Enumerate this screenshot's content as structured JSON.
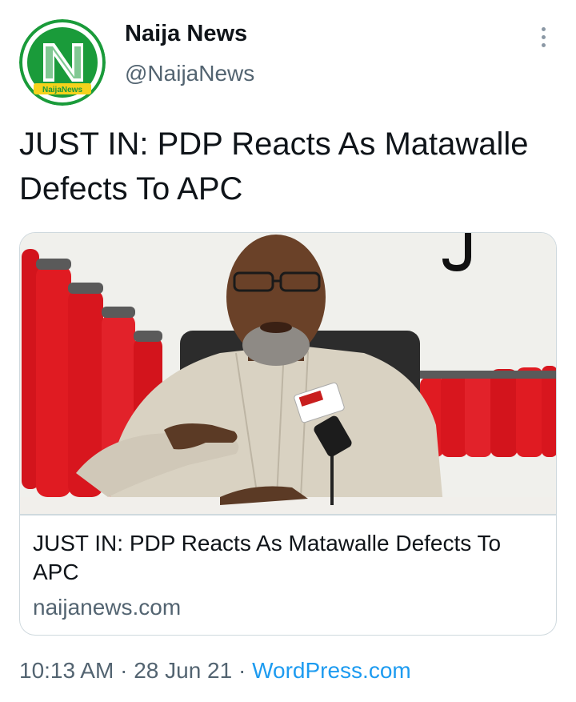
{
  "author": {
    "name": "Naija News",
    "handle": "@NaijaNews",
    "avatar_logo_text": "NaijaNews",
    "brand_green": "#1a9b3a"
  },
  "tweet": {
    "text": "JUST IN: PDP Reacts As Matawalle Defects To APC"
  },
  "card": {
    "title": "JUST IN: PDP Reacts As Matawalle Defects To APC",
    "domain": "naijanews.com",
    "image_description_icon": "press-conference-photo"
  },
  "meta": {
    "time": "10:13 AM",
    "separator": "·",
    "date": "28 Jun 21",
    "source": "WordPress.com"
  },
  "colors": {
    "text_primary": "#0f1419",
    "text_secondary": "#536471",
    "link": "#1d9bf0",
    "border": "#cfd9de"
  },
  "icons": {
    "more": "more-vertical-icon"
  }
}
